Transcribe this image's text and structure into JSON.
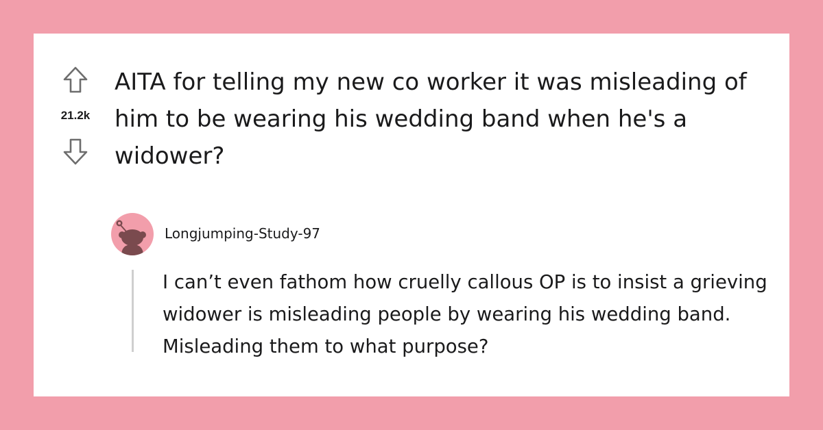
{
  "post": {
    "votes": "21.2k",
    "title": "AITA for telling my new co worker it was misleading of him to be wearing his wedding band when he's a widower?"
  },
  "comment": {
    "username": "Longjumping-Study-97",
    "body": "I can’t even fathom how cruelly callous OP is to insist a grieving widower is misleading people by wearing his wedding band. Misleading them to what purpose?"
  },
  "colors": {
    "background": "#f29eab",
    "card": "#ffffff",
    "text": "#1a1a1b",
    "avatar_bg": "#f29eab",
    "avatar_figure": "#7a4a4e",
    "thread_line": "#cfcfcf"
  },
  "icons": {
    "upvote": "arrow-up-icon",
    "downvote": "arrow-down-icon",
    "avatar": "snoo-avatar-icon"
  }
}
